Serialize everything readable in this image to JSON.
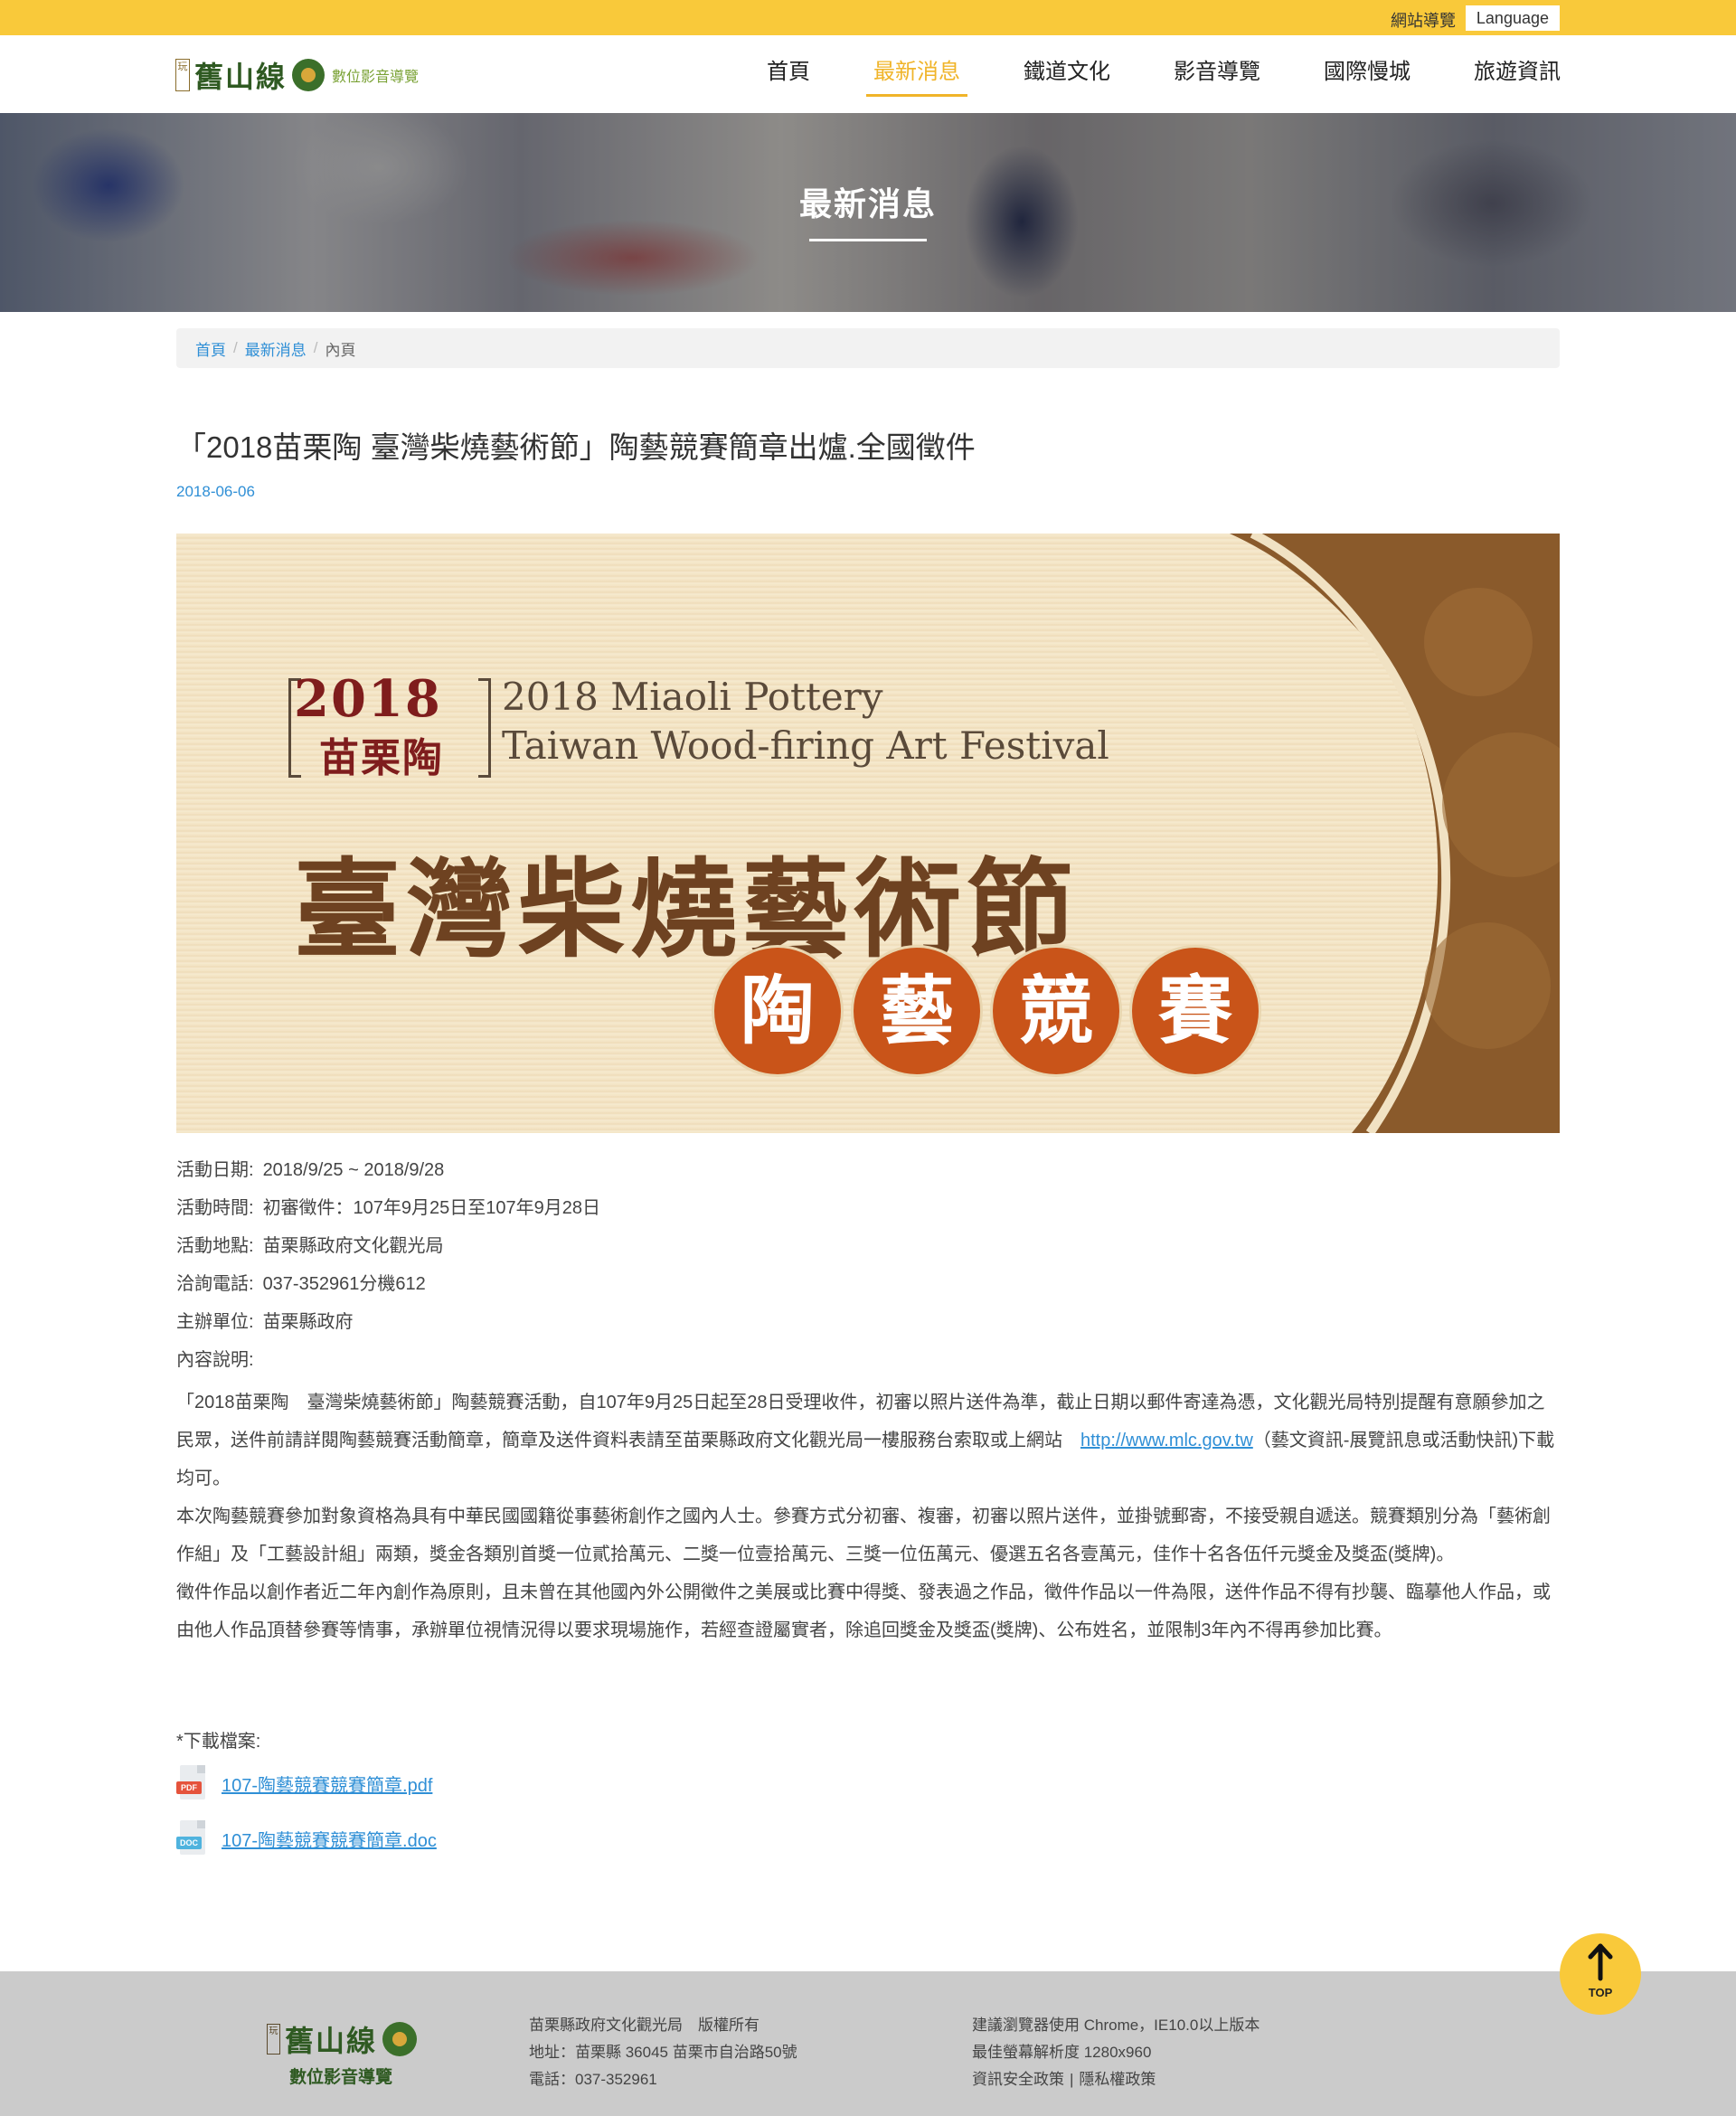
{
  "topbar": {
    "sitemap_label": "網站導覽",
    "language_label": "Language"
  },
  "header": {
    "logo_seal": "玩",
    "logo_name": "舊山線",
    "logo_sub": "數位影音導覽",
    "nav": [
      {
        "label": "首頁",
        "active": false
      },
      {
        "label": "最新消息",
        "active": true
      },
      {
        "label": "鐵道文化",
        "active": false
      },
      {
        "label": "影音導覽",
        "active": false
      },
      {
        "label": "國際慢城",
        "active": false
      },
      {
        "label": "旅遊資訊",
        "active": false
      }
    ]
  },
  "banner": {
    "title": "最新消息"
  },
  "breadcrumb": {
    "items": [
      "首頁",
      "最新消息"
    ],
    "current": "內頁"
  },
  "article": {
    "title": "「2018苗栗陶 臺灣柴燒藝術節」陶藝競賽簡章出爐.全國徵件",
    "date": "2018-06-06",
    "hero": {
      "year": "2018",
      "cn_small": "苗栗陶",
      "en_line1": "2018 Miaoli Pottery",
      "en_line2": "Taiwan Wood-firing Art Festival",
      "cn_big": "臺灣柴燒藝術節",
      "circles": [
        "陶",
        "藝",
        "競",
        "賽"
      ]
    },
    "info": [
      {
        "key": "活動日期:",
        "value": "2018/9/25 ~ 2018/9/28"
      },
      {
        "key": "活動時間:",
        "value": "初審徵件：107年9月25日至107年9月28日"
      },
      {
        "key": "活動地點:",
        "value": "苗栗縣政府文化觀光局"
      },
      {
        "key": "洽詢電話:",
        "value": "037-352961分機612"
      },
      {
        "key": "主辦單位:",
        "value": "苗栗縣政府"
      },
      {
        "key": "內容說明:",
        "value": ""
      }
    ],
    "desc_p1_a": "「2018苗栗陶　臺灣柴燒藝術節」陶藝競賽活動，自107年9月25日起至28日受理收件，初審以照片送件為準，截止日期以郵件寄達為憑，文化觀光局特別提醒有意願參加之民眾，送件前請詳閱陶藝競賽活動簡章，簡章及送件資料表請至苗栗縣政府文化觀光局一樓服務台索取或上網站　",
    "desc_p1_link": "http://www.mlc.gov.tw",
    "desc_p1_b": "（藝文資訊-展覽訊息或活動快訊)下載均可。",
    "desc_p2": "本次陶藝競賽參加對象資格為具有中華民國國籍從事藝術創作之國內人士。參賽方式分初審、複審，初審以照片送件，並掛號郵寄，不接受親自遞送。競賽類別分為「藝術創作組」及「工藝設計組」兩類，獎金各類別首獎一位貳拾萬元、二獎一位壹拾萬元、三獎一位伍萬元、優選五名各壹萬元，佳作十名各伍仟元獎金及獎盃(獎牌)。",
    "desc_p3": "徵件作品以創作者近二年內創作為原則，且未曾在其他國內外公開徵件之美展或比賽中得獎、發表過之作品，徵件作品以一件為限，送件作品不得有抄襲、臨摹他人作品，或由他人作品頂替參賽等情事，承辦單位視情況得以要求現場施作，若經查證屬實者，除追回獎金及獎盃(獎牌)、公布姓名，並限制3年內不得再參加比賽。",
    "downloads_title": "*下載檔案:",
    "downloads": [
      {
        "type": "PDF",
        "color": "#e5533c",
        "name": "107-陶藝競賽競賽簡章.pdf"
      },
      {
        "type": "DOC",
        "color": "#4fb3de",
        "name": "107-陶藝競賽競賽簡章.doc"
      }
    ]
  },
  "top_button": {
    "label": "TOP"
  },
  "footer": {
    "logo_seal": "玩",
    "logo_name": "舊山線",
    "logo_sub": "數位影音導覽",
    "col1": [
      "苗栗縣政府文化觀光局　版權所有",
      "地址：苗栗縣 36045 苗栗市自治路50號",
      "電話：037-352961"
    ],
    "col2_line1": "建議瀏覽器使用 Chrome，IE10.0以上版本",
    "col2_line2": "最佳螢幕解析度 1280x960",
    "col2_link1": "資訊安全政策",
    "col2_link2": "隱私權政策"
  },
  "colors": {
    "brand_yellow": "#f9c93a",
    "link_blue": "#2f8fd6",
    "brand_green": "#2f5a22"
  }
}
